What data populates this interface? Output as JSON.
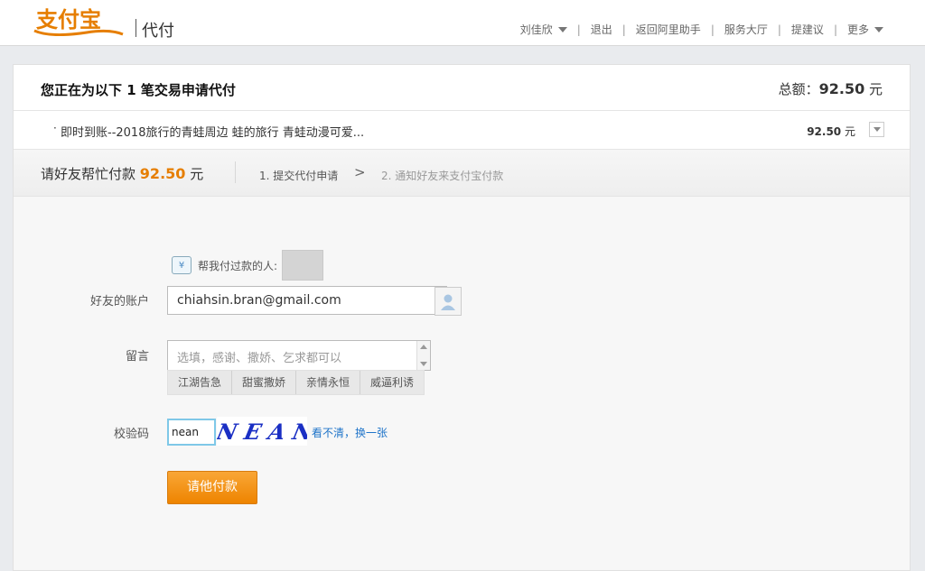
{
  "header": {
    "logo_text": "支付宝",
    "product": "代付",
    "nav": [
      {
        "label": "刘佳欣",
        "dropdown": true
      },
      {
        "label": "退出"
      },
      {
        "label": "返回阿里助手"
      },
      {
        "label": "服务大厅"
      },
      {
        "label": "提建议"
      },
      {
        "label": "更多",
        "dropdown": true
      }
    ],
    "separator": "|"
  },
  "summary": {
    "title": "您正在为以下 1 笔交易申请代付",
    "total_label": "总额：",
    "total_amount": "92.50",
    "currency": "元"
  },
  "order": {
    "bullet": "·",
    "description": "即时到账--2018旅行的青蛙周边 蛙的旅行 青蛙动漫可爱...",
    "amount": "92.50",
    "currency": "元"
  },
  "steps": {
    "ask_prefix": "请好友帮忙付款",
    "ask_amount": "92.50",
    "ask_currency": "元",
    "step1": "1. 提交代付申请",
    "arrow": ">",
    "step2": "2. 通知好友来支付宝付款"
  },
  "form": {
    "helpers_label": "帮我付过款的人:",
    "helpers_icon": "¥",
    "account_label": "好友的账户",
    "account_value": "chiahsin.bran@gmail.com",
    "message_label": "留言",
    "message_placeholder": "选填，感谢、撒娇、乞求都可以",
    "quick_phrases": [
      "江湖告急",
      "甜蜜撒娇",
      "亲情永恒",
      "威逼利诱"
    ],
    "code_label": "校验码",
    "code_value": "nean",
    "refresh_label": "看不清，换一张",
    "submit_label": "请他付款"
  },
  "colors": {
    "accent_orange": "#ee8400",
    "link_blue": "#1f74c9",
    "amount_orange": "#e67e00"
  }
}
